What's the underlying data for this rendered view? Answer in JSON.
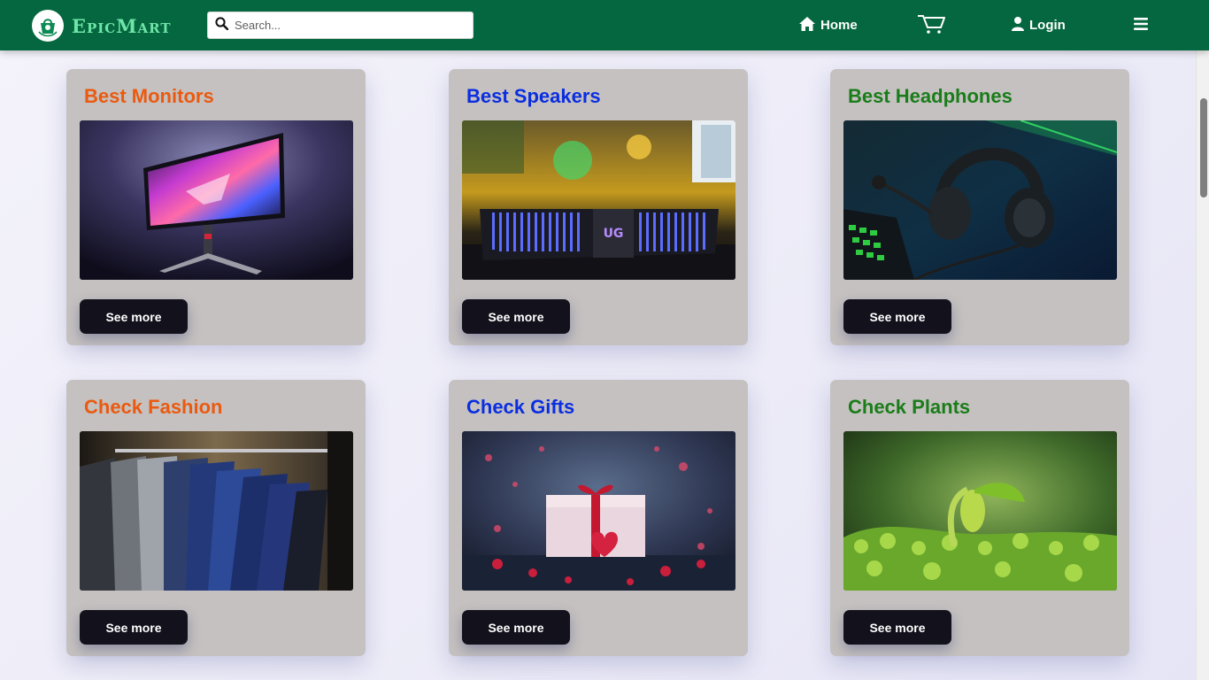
{
  "colors": {
    "navbar_bg": "#05673f",
    "brand_text": "#6ee6a8",
    "card_bg": "#c5c1c0",
    "button_bg": "#12111c",
    "title_orange": "#ea5a10",
    "title_blue": "#0a2ee0",
    "title_green": "#1a7d1a"
  },
  "navbar": {
    "brand": "EpicMart",
    "logo_icon": "shopping-bag-icon",
    "search_placeholder": "Search...",
    "home_label": "Home",
    "home_icon": "home-icon",
    "cart_icon": "cart-icon",
    "login_label": "Login",
    "login_icon": "user-icon",
    "menu_icon": "hamburger-menu-icon"
  },
  "cards": [
    {
      "title": "Best Monitors",
      "title_color": "#ea5a10",
      "image": "gaming-monitor-image",
      "button": "See more"
    },
    {
      "title": "Best Speakers",
      "title_color": "#0a2ee0",
      "image": "soundbar-speaker-image",
      "button": "See more"
    },
    {
      "title": "Best Headphones",
      "title_color": "#1a7d1a",
      "image": "gaming-headset-image",
      "button": "See more"
    },
    {
      "title": "Check Fashion",
      "title_color": "#ea5a10",
      "image": "suits-on-rack-image",
      "button": "See more"
    },
    {
      "title": "Check Gifts",
      "title_color": "#0a2ee0",
      "image": "gift-box-hearts-image",
      "button": "See more"
    },
    {
      "title": "Check Plants",
      "title_color": "#1a7d1a",
      "image": "sprouting-plant-image",
      "button": "See more"
    }
  ]
}
